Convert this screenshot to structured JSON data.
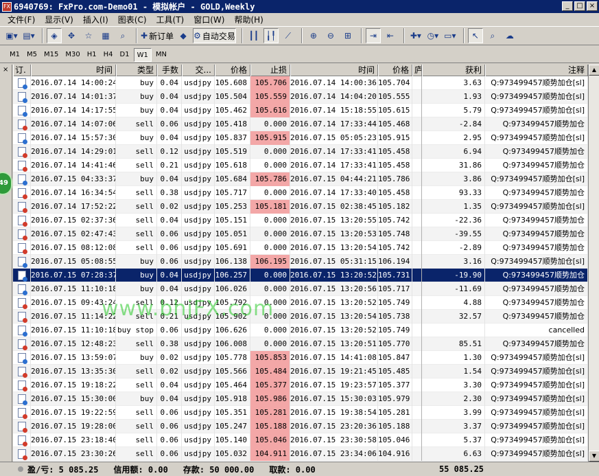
{
  "window": {
    "title": "6940769: FxPro.com-Demo01 - 模拟帐户 - GOLD,Weekly",
    "app_icon": "FX"
  },
  "menu": [
    "文件(F)",
    "显示(V)",
    "插入(I)",
    "图表(C)",
    "工具(T)",
    "窗口(W)",
    "帮助(H)"
  ],
  "toolbar": {
    "new_order_label": "新订单",
    "auto_trade_label": "自动交易"
  },
  "periods": [
    "M1",
    "M5",
    "M15",
    "M30",
    "H1",
    "H4",
    "D1",
    "W1",
    "MN"
  ],
  "active_period": "W1",
  "balloon_count": "49",
  "columns": {
    "order": "订.",
    "open_time": "时间",
    "type": "类型",
    "lots": "手数",
    "symbol": "交...",
    "open_price": "价格",
    "stop_loss": "止损",
    "close_time": "时间",
    "close_price": "价格",
    "extra": "庐",
    "profit": "获利",
    "comment": "注释"
  },
  "rows": [
    {
      "open_time": "2016.07.14 14:00:24",
      "type": "buy",
      "lots": "0.04",
      "symbol": "usdjpy",
      "open_price": "105.608",
      "stop_loss": "105.706",
      "sl_hit": true,
      "close_time": "2016.07.14 14:00:36",
      "close_price": "105.704",
      "profit": "3.63",
      "comment": "Q:973499457顺势加仓[sl]",
      "side": "buy"
    },
    {
      "open_time": "2016.07.14 14:01:37",
      "type": "buy",
      "lots": "0.04",
      "symbol": "usdjpy",
      "open_price": "105.504",
      "stop_loss": "105.559",
      "sl_hit": true,
      "close_time": "2016.07.14 14:04:20",
      "close_price": "105.555",
      "profit": "1.93",
      "comment": "Q:973499457顺势加仓[sl]",
      "side": "buy"
    },
    {
      "open_time": "2016.07.14 14:17:55",
      "type": "buy",
      "lots": "0.04",
      "symbol": "usdjpy",
      "open_price": "105.462",
      "stop_loss": "105.616",
      "sl_hit": true,
      "close_time": "2016.07.14 15:18:55",
      "close_price": "105.615",
      "profit": "5.79",
      "comment": "Q:973499457顺势加仓[sl]",
      "side": "buy"
    },
    {
      "open_time": "2016.07.14 14:07:06",
      "type": "sell",
      "lots": "0.06",
      "symbol": "usdjpy",
      "open_price": "105.418",
      "stop_loss": "0.000",
      "sl_hit": false,
      "close_time": "2016.07.14 17:33:44",
      "close_price": "105.468",
      "profit": "-2.84",
      "comment": "Q:973499457顺势加仓",
      "side": "sell"
    },
    {
      "open_time": "2016.07.14 15:57:30",
      "type": "buy",
      "lots": "0.04",
      "symbol": "usdjpy",
      "open_price": "105.837",
      "stop_loss": "105.915",
      "sl_hit": true,
      "close_time": "2016.07.15 05:05:23",
      "close_price": "105.915",
      "profit": "2.95",
      "comment": "Q:973499457顺势加仓[sl]",
      "side": "buy"
    },
    {
      "open_time": "2016.07.14 14:29:01",
      "type": "sell",
      "lots": "0.12",
      "symbol": "usdjpy",
      "open_price": "105.519",
      "stop_loss": "0.000",
      "sl_hit": false,
      "close_time": "2016.07.14 17:33:41",
      "close_price": "105.458",
      "profit": "6.94",
      "comment": "Q:973499457顺势加仓",
      "side": "sell"
    },
    {
      "open_time": "2016.07.14 14:41:46",
      "type": "sell",
      "lots": "0.21",
      "symbol": "usdjpy",
      "open_price": "105.618",
      "stop_loss": "0.000",
      "sl_hit": false,
      "close_time": "2016.07.14 17:33:41",
      "close_price": "105.458",
      "profit": "31.86",
      "comment": "Q:973499457顺势加仓",
      "side": "sell"
    },
    {
      "open_time": "2016.07.15 04:33:37",
      "type": "buy",
      "lots": "0.04",
      "symbol": "usdjpy",
      "open_price": "105.684",
      "stop_loss": "105.786",
      "sl_hit": true,
      "close_time": "2016.07.15 04:44:21",
      "close_price": "105.786",
      "profit": "3.86",
      "comment": "Q:973499457顺势加仓[sl]",
      "side": "buy"
    },
    {
      "open_time": "2016.07.14 16:34:54",
      "type": "sell",
      "lots": "0.38",
      "symbol": "usdjpy",
      "open_price": "105.717",
      "stop_loss": "0.000",
      "sl_hit": false,
      "close_time": "2016.07.14 17:33:40",
      "close_price": "105.458",
      "profit": "93.33",
      "comment": "Q:973499457顺势加仓",
      "side": "sell"
    },
    {
      "open_time": "2016.07.14 17:52:22",
      "type": "sell",
      "lots": "0.02",
      "symbol": "usdjpy",
      "open_price": "105.253",
      "stop_loss": "105.181",
      "sl_hit": true,
      "close_time": "2016.07.15 02:38:45",
      "close_price": "105.182",
      "profit": "1.35",
      "comment": "Q:973499457顺势加仓[sl]",
      "side": "sell"
    },
    {
      "open_time": "2016.07.15 02:37:36",
      "type": "sell",
      "lots": "0.04",
      "symbol": "usdjpy",
      "open_price": "105.151",
      "stop_loss": "0.000",
      "sl_hit": false,
      "close_time": "2016.07.15 13:20:55",
      "close_price": "105.742",
      "profit": "-22.36",
      "comment": "Q:973499457顺势加仓",
      "side": "sell"
    },
    {
      "open_time": "2016.07.15 02:47:43",
      "type": "sell",
      "lots": "0.06",
      "symbol": "usdjpy",
      "open_price": "105.051",
      "stop_loss": "0.000",
      "sl_hit": false,
      "close_time": "2016.07.15 13:20:53",
      "close_price": "105.748",
      "profit": "-39.55",
      "comment": "Q:973499457顺势加仓",
      "side": "sell"
    },
    {
      "open_time": "2016.07.15 08:12:08",
      "type": "sell",
      "lots": "0.06",
      "symbol": "usdjpy",
      "open_price": "105.691",
      "stop_loss": "0.000",
      "sl_hit": false,
      "close_time": "2016.07.15 13:20:54",
      "close_price": "105.742",
      "profit": "-2.89",
      "comment": "Q:973499457顺势加仓",
      "side": "sell"
    },
    {
      "open_time": "2016.07.15 05:08:55",
      "type": "buy",
      "lots": "0.06",
      "symbol": "usdjpy",
      "open_price": "106.138",
      "stop_loss": "106.195",
      "sl_hit": true,
      "close_time": "2016.07.15 05:31:15",
      "close_price": "106.194",
      "profit": "3.16",
      "comment": "Q:973499457顺势加仓[sl]",
      "side": "buy"
    },
    {
      "open_time": "2016.07.15 07:28:37",
      "type": "buy",
      "lots": "0.04",
      "symbol": "usdjpy",
      "open_price": "106.257",
      "stop_loss": "0.000",
      "sl_hit": false,
      "close_time": "2016.07.15 13:20:52",
      "close_price": "105.731",
      "profit": "-19.90",
      "comment": "Q:973499457顺势加仓",
      "side": "buy",
      "selected": true
    },
    {
      "open_time": "2016.07.15 11:10:18",
      "type": "buy",
      "lots": "0.04",
      "symbol": "usdjpy",
      "open_price": "106.026",
      "stop_loss": "0.000",
      "sl_hit": false,
      "close_time": "2016.07.15 13:20:56",
      "close_price": "105.717",
      "profit": "-11.69",
      "comment": "Q:973499457顺势加仓",
      "side": "buy"
    },
    {
      "open_time": "2016.07.15 09:43:24",
      "type": "sell",
      "lots": "0.12",
      "symbol": "usdjpy",
      "open_price": "105.792",
      "stop_loss": "0.000",
      "sl_hit": false,
      "close_time": "2016.07.15 13:20:52",
      "close_price": "105.749",
      "profit": "4.88",
      "comment": "Q:973499457顺势加仓",
      "side": "sell"
    },
    {
      "open_time": "2016.07.15 11:14:22",
      "type": "sell",
      "lots": "0.21",
      "symbol": "usdjpy",
      "open_price": "105.902",
      "stop_loss": "0.000",
      "sl_hit": false,
      "close_time": "2016.07.15 13:20:54",
      "close_price": "105.738",
      "profit": "32.57",
      "comment": "Q:973499457顺势加仓",
      "side": "sell"
    },
    {
      "open_time": "2016.07.15 11:10:18",
      "type": "buy stop",
      "lots": "0.06",
      "symbol": "usdjpy",
      "open_price": "106.626",
      "stop_loss": "0.000",
      "sl_hit": false,
      "close_time": "2016.07.15 13:20:52",
      "close_price": "105.749",
      "profit": "",
      "comment": "cancelled",
      "side": "buy"
    },
    {
      "open_time": "2016.07.15 12:48:23",
      "type": "sell",
      "lots": "0.38",
      "symbol": "usdjpy",
      "open_price": "106.008",
      "stop_loss": "0.000",
      "sl_hit": false,
      "close_time": "2016.07.15 13:20:51",
      "close_price": "105.770",
      "profit": "85.51",
      "comment": "Q:973499457顺势加仓",
      "side": "sell"
    },
    {
      "open_time": "2016.07.15 13:59:07",
      "type": "buy",
      "lots": "0.02",
      "symbol": "usdjpy",
      "open_price": "105.778",
      "stop_loss": "105.853",
      "sl_hit": true,
      "close_time": "2016.07.15 14:41:08",
      "close_price": "105.847",
      "profit": "1.30",
      "comment": "Q:973499457顺势加仓[sl]",
      "side": "buy"
    },
    {
      "open_time": "2016.07.15 13:35:30",
      "type": "sell",
      "lots": "0.02",
      "symbol": "usdjpy",
      "open_price": "105.566",
      "stop_loss": "105.484",
      "sl_hit": true,
      "close_time": "2016.07.15 19:21:45",
      "close_price": "105.485",
      "profit": "1.54",
      "comment": "Q:973499457顺势加仓[sl]",
      "side": "sell"
    },
    {
      "open_time": "2016.07.15 19:18:22",
      "type": "sell",
      "lots": "0.04",
      "symbol": "usdjpy",
      "open_price": "105.464",
      "stop_loss": "105.377",
      "sl_hit": true,
      "close_time": "2016.07.15 19:23:57",
      "close_price": "105.377",
      "profit": "3.30",
      "comment": "Q:973499457顺势加仓[sl]",
      "side": "sell"
    },
    {
      "open_time": "2016.07.15 15:30:00",
      "type": "buy",
      "lots": "0.04",
      "symbol": "usdjpy",
      "open_price": "105.918",
      "stop_loss": "105.986",
      "sl_hit": true,
      "close_time": "2016.07.15 15:30:03",
      "close_price": "105.979",
      "profit": "2.30",
      "comment": "Q:973499457顺势加仓[sl]",
      "side": "buy"
    },
    {
      "open_time": "2016.07.15 19:22:59",
      "type": "sell",
      "lots": "0.06",
      "symbol": "usdjpy",
      "open_price": "105.351",
      "stop_loss": "105.281",
      "sl_hit": true,
      "close_time": "2016.07.15 19:38:54",
      "close_price": "105.281",
      "profit": "3.99",
      "comment": "Q:973499457顺势加仓[sl]",
      "side": "sell"
    },
    {
      "open_time": "2016.07.15 19:28:00",
      "type": "sell",
      "lots": "0.06",
      "symbol": "usdjpy",
      "open_price": "105.247",
      "stop_loss": "105.188",
      "sl_hit": true,
      "close_time": "2016.07.15 23:20:36",
      "close_price": "105.188",
      "profit": "3.37",
      "comment": "Q:973499457顺势加仓[sl]",
      "side": "sell"
    },
    {
      "open_time": "2016.07.15 23:18:40",
      "type": "sell",
      "lots": "0.06",
      "symbol": "usdjpy",
      "open_price": "105.140",
      "stop_loss": "105.046",
      "sl_hit": true,
      "close_time": "2016.07.15 23:30:58",
      "close_price": "105.046",
      "profit": "5.37",
      "comment": "Q:973499457顺势加仓[sl]",
      "side": "sell"
    },
    {
      "open_time": "2016.07.15 23:30:26",
      "type": "sell",
      "lots": "0.06",
      "symbol": "usdjpy",
      "open_price": "105.032",
      "stop_loss": "104.911",
      "sl_hit": true,
      "close_time": "2016.07.15 23:34:06",
      "close_price": "104.916",
      "profit": "6.63",
      "comment": "Q:973499457顺势加仓[sl]",
      "side": "sell"
    }
  ],
  "footer": {
    "pl": "盈/亏: 5 085.25",
    "credit": "信用额: 0.00",
    "deposit": "存款: 50 000.00",
    "withdrawal": "取款: 0.00",
    "total": "55 085.25"
  },
  "watermark": "www.bhjFX.com",
  "colors": {
    "title_bar": "#0a246a",
    "stop_loss_hit": "#f3a7a7",
    "selected_row": "#0a246a"
  }
}
